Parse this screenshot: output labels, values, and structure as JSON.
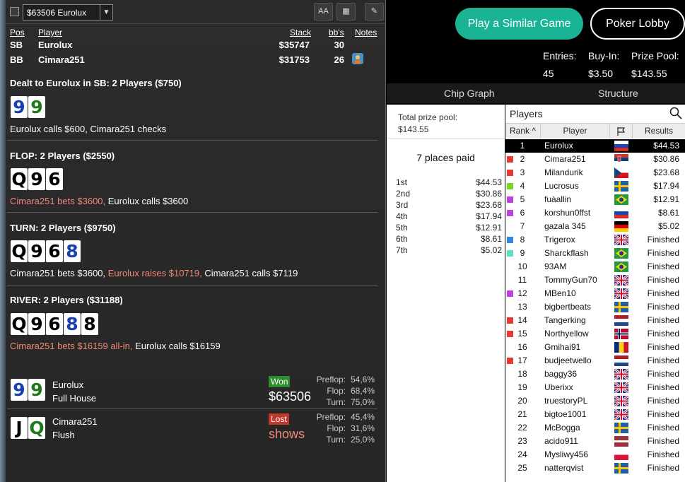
{
  "toolbar": {
    "hand_select": "$63506 Eurolux",
    "btn_font": "AA",
    "btn_grid": "▦",
    "btn_edit": "✎"
  },
  "table_headers": {
    "pos": "Pos",
    "player": "Player",
    "stack": "Stack",
    "bbs": "bb's",
    "notes": "Notes"
  },
  "players_header": [
    {
      "pos": "SB",
      "name": "Eurolux",
      "stack": "$35747",
      "bbs": "30"
    },
    {
      "pos": "BB",
      "name": "Cimara251",
      "stack": "$31753",
      "bbs": "26"
    }
  ],
  "preflop": {
    "title": "Dealt to Eurolux in SB: 2 Players ($750)",
    "cards": [
      {
        "rank": "9",
        "suit": "blue"
      },
      {
        "rank": "9",
        "suit": "green"
      }
    ],
    "action": [
      {
        "text": "Eurolux calls $600, Cimara251 checks",
        "hl": false
      }
    ]
  },
  "flop": {
    "title": "FLOP: 2 Players ($2550)",
    "cards": [
      {
        "rank": "Q",
        "suit": "black"
      },
      {
        "rank": "9",
        "suit": "black"
      },
      {
        "rank": "6",
        "suit": "black"
      }
    ],
    "action": [
      {
        "text": "Cimara251 bets $3600, ",
        "hl": true
      },
      {
        "text": "Eurolux calls $3600",
        "hl": false
      }
    ]
  },
  "turn": {
    "title": "TURN: 2 Players ($9750)",
    "cards": [
      {
        "rank": "Q",
        "suit": "black"
      },
      {
        "rank": "9",
        "suit": "black"
      },
      {
        "rank": "6",
        "suit": "black"
      },
      {
        "rank": "8",
        "suit": "blue"
      }
    ],
    "action": [
      {
        "text": "Cimara251 bets $3600, ",
        "hl": false
      },
      {
        "text": "Eurolux raises $10719, ",
        "hl": true
      },
      {
        "text": "Cimara251 calls $7119",
        "hl": false
      }
    ]
  },
  "river": {
    "title": "RIVER: 2 Players ($31188)",
    "cards": [
      {
        "rank": "Q",
        "suit": "black"
      },
      {
        "rank": "9",
        "suit": "black"
      },
      {
        "rank": "6",
        "suit": "black"
      },
      {
        "rank": "8",
        "suit": "blue"
      },
      {
        "rank": "8",
        "suit": "black"
      }
    ],
    "action": [
      {
        "text": "Cimara251 bets $16159 all-in, ",
        "hl": true
      },
      {
        "text": "Eurolux calls $16159",
        "hl": false
      }
    ]
  },
  "results": [
    {
      "name": "Eurolux",
      "hand": "Full House",
      "badge": "Won",
      "amount": "$63506",
      "cards": [
        {
          "rank": "9",
          "suit": "blue"
        },
        {
          "rank": "9",
          "suit": "green"
        }
      ],
      "eq_labels": [
        "Preflop:",
        "Flop:",
        "Turn:"
      ],
      "eq_values": [
        "54,6%",
        "68,4%",
        "75,0%"
      ]
    },
    {
      "name": "Cimara251",
      "hand": "Flush",
      "badge": "Lost",
      "amount": "shows",
      "cards": [
        {
          "rank": "J",
          "suit": "black"
        },
        {
          "rank": "Q",
          "suit": "green"
        }
      ],
      "eq_labels": [
        "Preflop:",
        "Flop:",
        "Turn:"
      ],
      "eq_values": [
        "45,4%",
        "31,6%",
        "25,0%"
      ]
    }
  ],
  "lobby": {
    "play_similar": "Play a Similar Game",
    "poker_lobby": "Poker Lobby",
    "entries_label": "Entries:",
    "entries": "45",
    "buyin_label": "Buy-In:",
    "buyin": "$3.50",
    "prize_label": "Prize Pool:",
    "prize": "$143.55",
    "tab_chip": "Chip Graph",
    "tab_structure": "Structure",
    "total_prize_label": "Total prize pool:",
    "total_prize": "$143.55",
    "places_paid": "7 places paid",
    "payouts": [
      {
        "place": "1st",
        "amount": "$44.53"
      },
      {
        "place": "2nd",
        "amount": "$30.86"
      },
      {
        "place": "3rd",
        "amount": "$23.68"
      },
      {
        "place": "4th",
        "amount": "$17.94"
      },
      {
        "place": "5th",
        "amount": "$12.91"
      },
      {
        "place": "6th",
        "amount": "$8.61"
      },
      {
        "place": "7th",
        "amount": "$5.02"
      }
    ],
    "players_title": "Players",
    "col_rank": "Rank",
    "col_player": "Player",
    "col_results": "Results",
    "rows": [
      {
        "rank": "1",
        "name": "Eurolux",
        "flag": "ru",
        "result": "$44.53",
        "mark": ""
      },
      {
        "rank": "2",
        "name": "Cimara251",
        "flag": "rs",
        "result": "$30.86",
        "mark": "#e53935"
      },
      {
        "rank": "3",
        "name": "Milandurik",
        "flag": "cz",
        "result": "$23.68",
        "mark": "#e53935"
      },
      {
        "rank": "4",
        "name": "Lucrosus",
        "flag": "se",
        "result": "$17.94",
        "mark": "#7bd321"
      },
      {
        "rank": "5",
        "name": "fuàallin",
        "flag": "br",
        "result": "$12.91",
        "mark": "#c040e0"
      },
      {
        "rank": "6",
        "name": "korshun0ffst",
        "flag": "ru",
        "result": "$8.61",
        "mark": "#c040e0"
      },
      {
        "rank": "7",
        "name": "gazala 345",
        "flag": "de",
        "result": "$5.02",
        "mark": ""
      },
      {
        "rank": "8",
        "name": "Trigerox",
        "flag": "gb",
        "result": "Finished",
        "mark": "#2b8ae0"
      },
      {
        "rank": "9",
        "name": "Sharckflash",
        "flag": "br",
        "result": "Finished",
        "mark": "#5be0c0"
      },
      {
        "rank": "10",
        "name": "93AM",
        "flag": "br",
        "result": "Finished",
        "mark": ""
      },
      {
        "rank": "11",
        "name": "TommyGun70",
        "flag": "gb",
        "result": "Finished",
        "mark": ""
      },
      {
        "rank": "12",
        "name": "MBen10",
        "flag": "gb",
        "result": "Finished",
        "mark": "#c040e0"
      },
      {
        "rank": "13",
        "name": "bigbertbeats",
        "flag": "se",
        "result": "Finished",
        "mark": ""
      },
      {
        "rank": "14",
        "name": "Tangerking",
        "flag": "nl",
        "result": "Finished",
        "mark": "#e53935"
      },
      {
        "rank": "15",
        "name": "Northyellow",
        "flag": "no",
        "result": "Finished",
        "mark": "#e53935"
      },
      {
        "rank": "16",
        "name": "Gmihai91",
        "flag": "ro",
        "result": "Finished",
        "mark": ""
      },
      {
        "rank": "17",
        "name": "budjeetwello",
        "flag": "nl",
        "result": "Finished",
        "mark": "#e53935"
      },
      {
        "rank": "18",
        "name": "baggy36",
        "flag": "gb",
        "result": "Finished",
        "mark": ""
      },
      {
        "rank": "19",
        "name": "Uberixx",
        "flag": "gb",
        "result": "Finished",
        "mark": ""
      },
      {
        "rank": "20",
        "name": "truestoryPL",
        "flag": "gb",
        "result": "Finished",
        "mark": ""
      },
      {
        "rank": "21",
        "name": "bigtoe1001",
        "flag": "gb",
        "result": "Finished",
        "mark": ""
      },
      {
        "rank": "22",
        "name": "McBogga",
        "flag": "se",
        "result": "Finished",
        "mark": ""
      },
      {
        "rank": "23",
        "name": "acido911",
        "flag": "lv",
        "result": "Finished",
        "mark": ""
      },
      {
        "rank": "24",
        "name": "Mysliwy456",
        "flag": "pl",
        "result": "Finished",
        "mark": ""
      },
      {
        "rank": "25",
        "name": "natterqvist",
        "flag": "se",
        "result": "Finished",
        "mark": ""
      }
    ]
  }
}
